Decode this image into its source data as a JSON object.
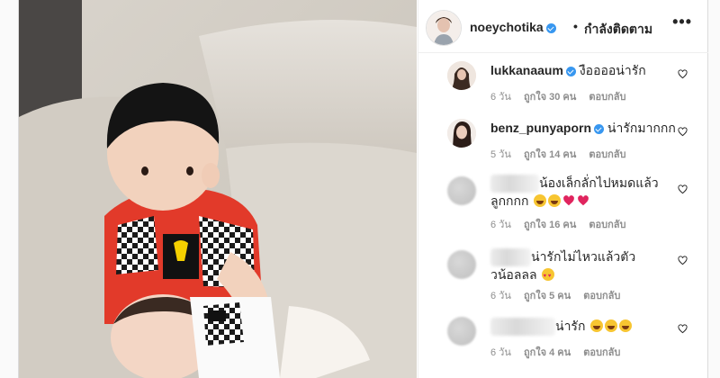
{
  "post": {
    "username": "noeychotika",
    "separator": "•",
    "follow_status": "กำลังติดตาม",
    "more_label": "•••"
  },
  "comments": [
    {
      "user": "lukkanaaum",
      "verified": true,
      "text": "งืออออน่ารัก",
      "age": "6 วัน",
      "likes": "ถูกใจ 30 คน",
      "reply": "ตอบกลับ"
    },
    {
      "user": "benz_punyaporn",
      "verified": true,
      "text": "น่ารักมากกก",
      "age": "5 วัน",
      "likes": "ถูกใจ 14 คน",
      "reply": "ตอบกลับ"
    },
    {
      "user": "",
      "verified": false,
      "text": "น้องเล็กลั่กไปหมดแล้วลูกกกก",
      "age": "6 วัน",
      "likes": "ถูกใจ 16 คน",
      "reply": "ตอบกลับ"
    },
    {
      "user": "",
      "verified": false,
      "text": "น่ารักไม่ไหวแล้วตัววน้อลลล",
      "age": "6 วัน",
      "likes": "ถูกใจ 5 คน",
      "reply": "ตอบกลับ"
    },
    {
      "user": "",
      "verified": false,
      "text": "น่ารัก",
      "age": "6 วัน",
      "likes": "ถูกใจ 4 คน",
      "reply": "ตอบกลับ"
    }
  ],
  "icons": {
    "verified": "verified-badge-icon",
    "like": "heart-outline-icon",
    "more": "more-options-icon"
  },
  "colors": {
    "verified": "#3897f0",
    "meta_text": "#8e8e8e",
    "border": "#dbdbdb"
  }
}
